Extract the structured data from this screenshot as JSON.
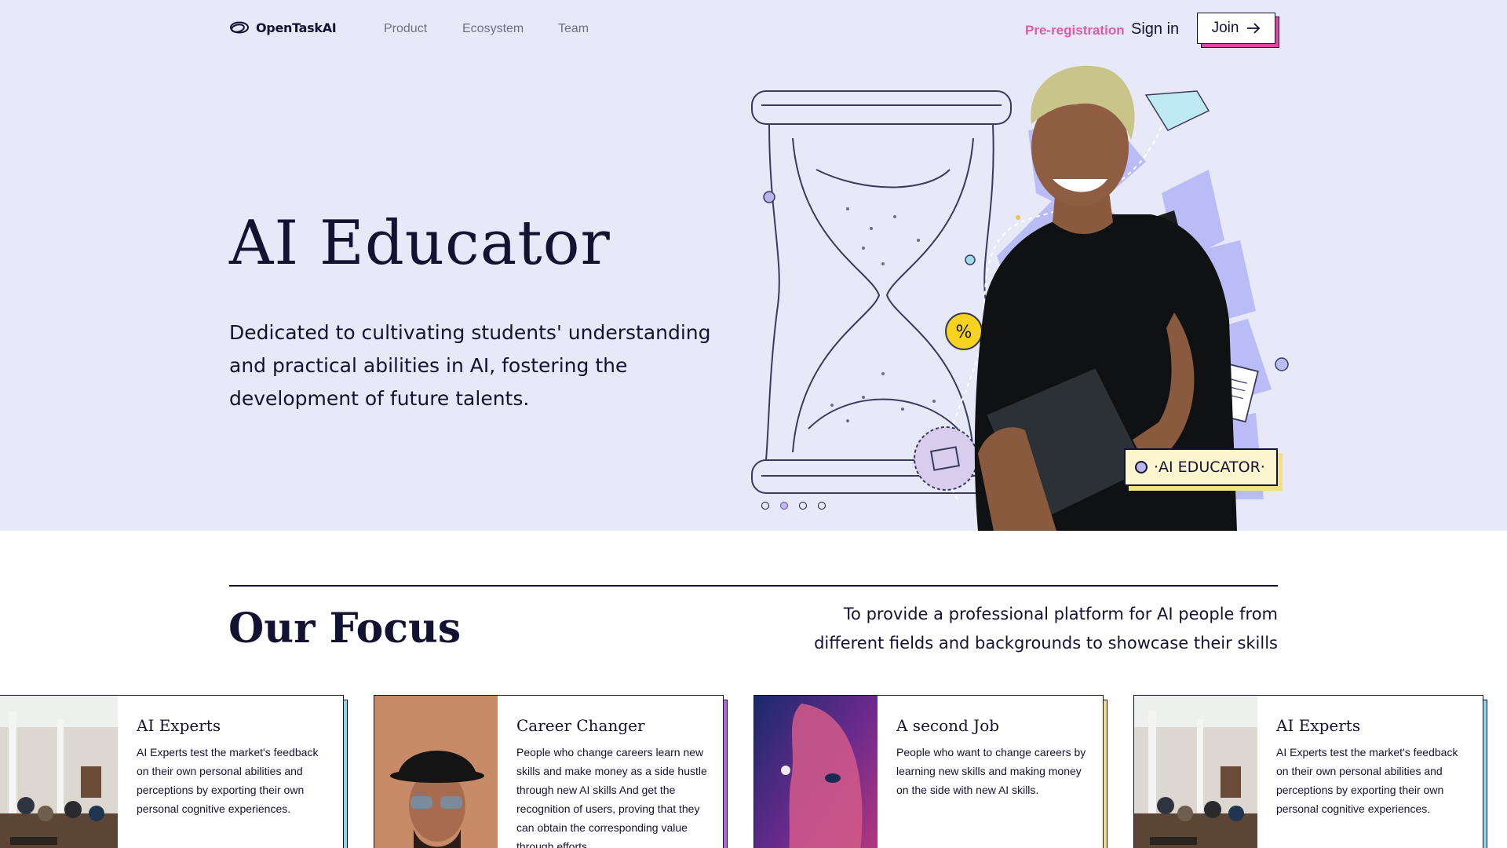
{
  "brand": {
    "name": "OpenTaskAI"
  },
  "nav": {
    "links": [
      "Product",
      "Ecosystem",
      "Team"
    ],
    "preregistration": "Pre-registration",
    "sign_in": "Sign in",
    "join": "Join"
  },
  "hero": {
    "title": "AI Educator",
    "description": "Dedicated to cultivating students' understanding and practical abilities in AI, fostering the development of future talents.",
    "badge": "·AI EDUCATOR·",
    "slides": {
      "count": 4,
      "active": 2
    }
  },
  "focus": {
    "title": "Our Focus",
    "description": "To provide a professional platform for AI people from different fields and backgrounds to showcase their skills",
    "cards": [
      {
        "title": "AI Experts",
        "description": "AI Experts test the market's feedback on their own personal abilities and perceptions by exporting their own personal cognitive experiences.",
        "image": "cafe-interior-photo",
        "accent": "#8fd6e8"
      },
      {
        "title": "Career Changer",
        "description": "People who change careers learn new skills and make money as a side hustle through new AI skills And get the recognition of users, proving that they can obtain the corresponding value through efforts.",
        "image": "man-hat-sunglasses-photo",
        "accent": "#b26ad9"
      },
      {
        "title": "A second Job",
        "description": "People who want to change careers by learning new skills and making money on the side with new AI skills.",
        "image": "neon-portrait-photo",
        "accent": "#f0e08a"
      },
      {
        "title": "AI Experts",
        "description": "AI Experts test the market's feedback on their own personal abilities and perceptions by exporting their own personal cognitive experiences.",
        "image": "cafe-interior-photo",
        "accent": "#8fd6e8"
      }
    ]
  },
  "colors": {
    "hero_bg": "#e8e9f8",
    "ink": "#141233",
    "pink_accent": "#e05aa8",
    "lavender": "#b9bcf6",
    "badge_bg": "#fdf6cf"
  }
}
